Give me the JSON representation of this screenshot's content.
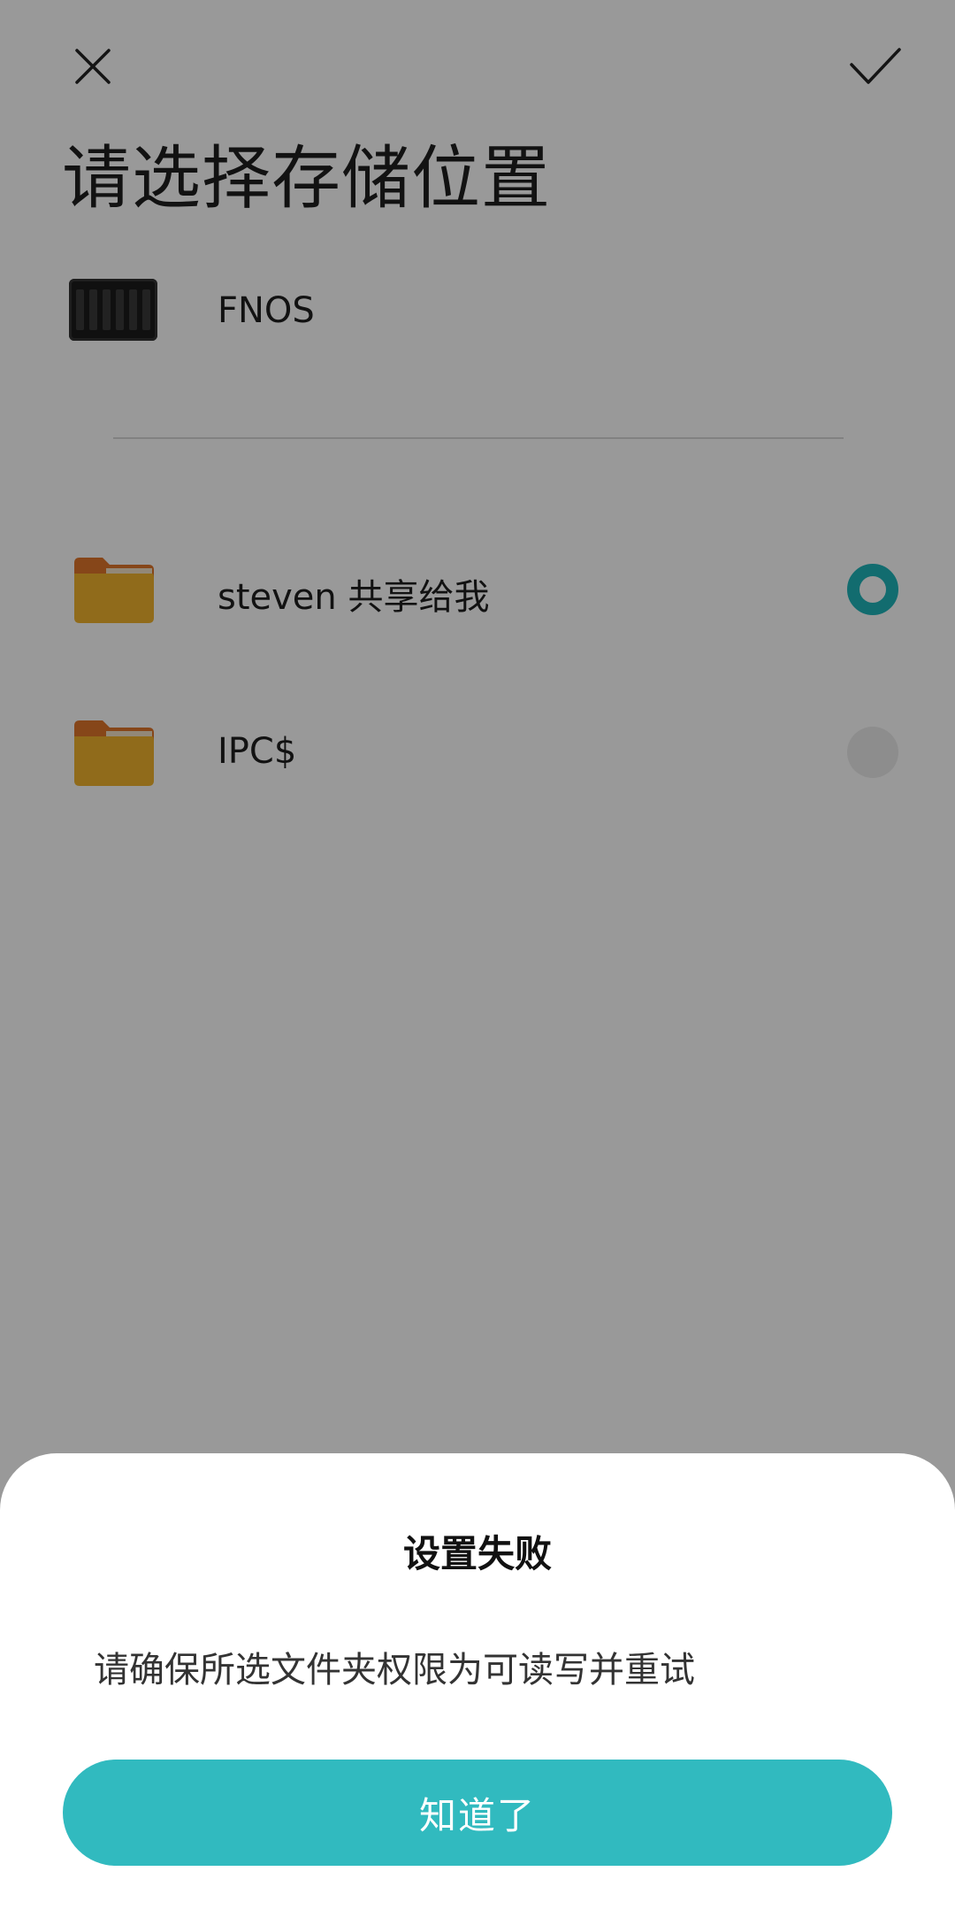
{
  "header": {
    "close_icon": "close-icon",
    "confirm_icon": "check-icon",
    "title": "请选择存储位置"
  },
  "device": {
    "icon": "nas-device-icon",
    "name": "FNOS"
  },
  "folders": [
    {
      "icon": "folder-icon",
      "name": "steven 共享给我",
      "selected": true
    },
    {
      "icon": "folder-icon",
      "name": "IPC$",
      "selected": false
    }
  ],
  "dialog": {
    "title": "设置失败",
    "message": "请确保所选文件夹权限为可读写并重试",
    "button_label": "知道了"
  },
  "colors": {
    "accent": "#31babf",
    "radio_selected": "#1fb4ba",
    "folder_body": "#f0b22e",
    "folder_tab": "#e0762a",
    "scrim": "rgba(0,0,0,0.40)"
  }
}
